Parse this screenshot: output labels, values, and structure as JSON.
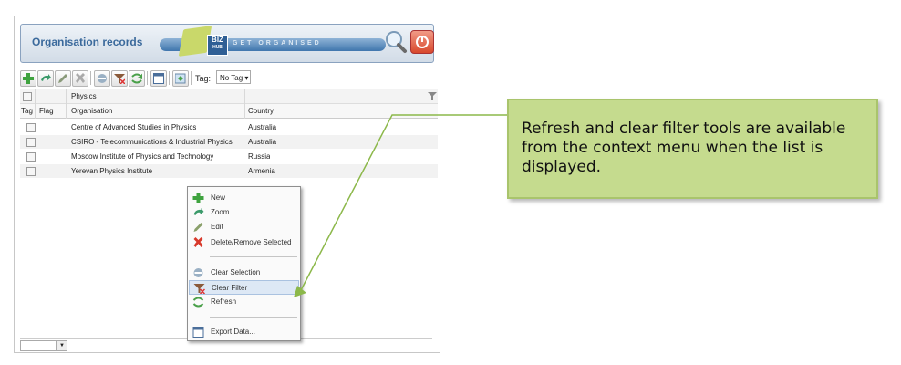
{
  "header": {
    "title": "Organisation records",
    "logo_text": "BIZ",
    "logo_sub": "HUB",
    "banner_text": "GET ORGANISED"
  },
  "toolbar": {
    "tag_label": "Tag:",
    "tag_value": "No Tag"
  },
  "grid": {
    "filter_value": "Physics",
    "columns": [
      "Tag",
      "Flag",
      "Organisation",
      "Country"
    ],
    "rows": [
      {
        "organisation": "Centre of Advanced Studies in Physics",
        "country": "Australia"
      },
      {
        "organisation": "CSIRO - Telecommunications & Industrial Physics",
        "country": "Australia"
      },
      {
        "organisation": "Moscow Institute of Physics and Technology",
        "country": "Russia"
      },
      {
        "organisation": "Yerevan Physics Institute",
        "country": "Armenia"
      }
    ]
  },
  "context_menu": {
    "items": [
      {
        "label": "New",
        "icon": "plus-icon"
      },
      {
        "label": "Zoom",
        "icon": "zoom-arrow-icon"
      },
      {
        "label": "Edit",
        "icon": "pencil-icon"
      },
      {
        "label": "Delete/Remove Selected",
        "icon": "delete-x-icon"
      },
      {
        "label": "Clear Selection",
        "icon": "clear-selection-icon"
      },
      {
        "label": "Clear Filter",
        "icon": "clear-filter-icon"
      },
      {
        "label": "Refresh",
        "icon": "refresh-icon"
      },
      {
        "label": "Export Data...",
        "icon": "export-table-icon"
      }
    ],
    "highlighted": "Clear Filter"
  },
  "callout": {
    "text": "Refresh and clear filter tools are available from the context menu when the list is displayed."
  },
  "colors": {
    "title_blue": "#3b6a9c",
    "callout_green": "#c5db8e",
    "pointer_green": "#8cb84a"
  }
}
